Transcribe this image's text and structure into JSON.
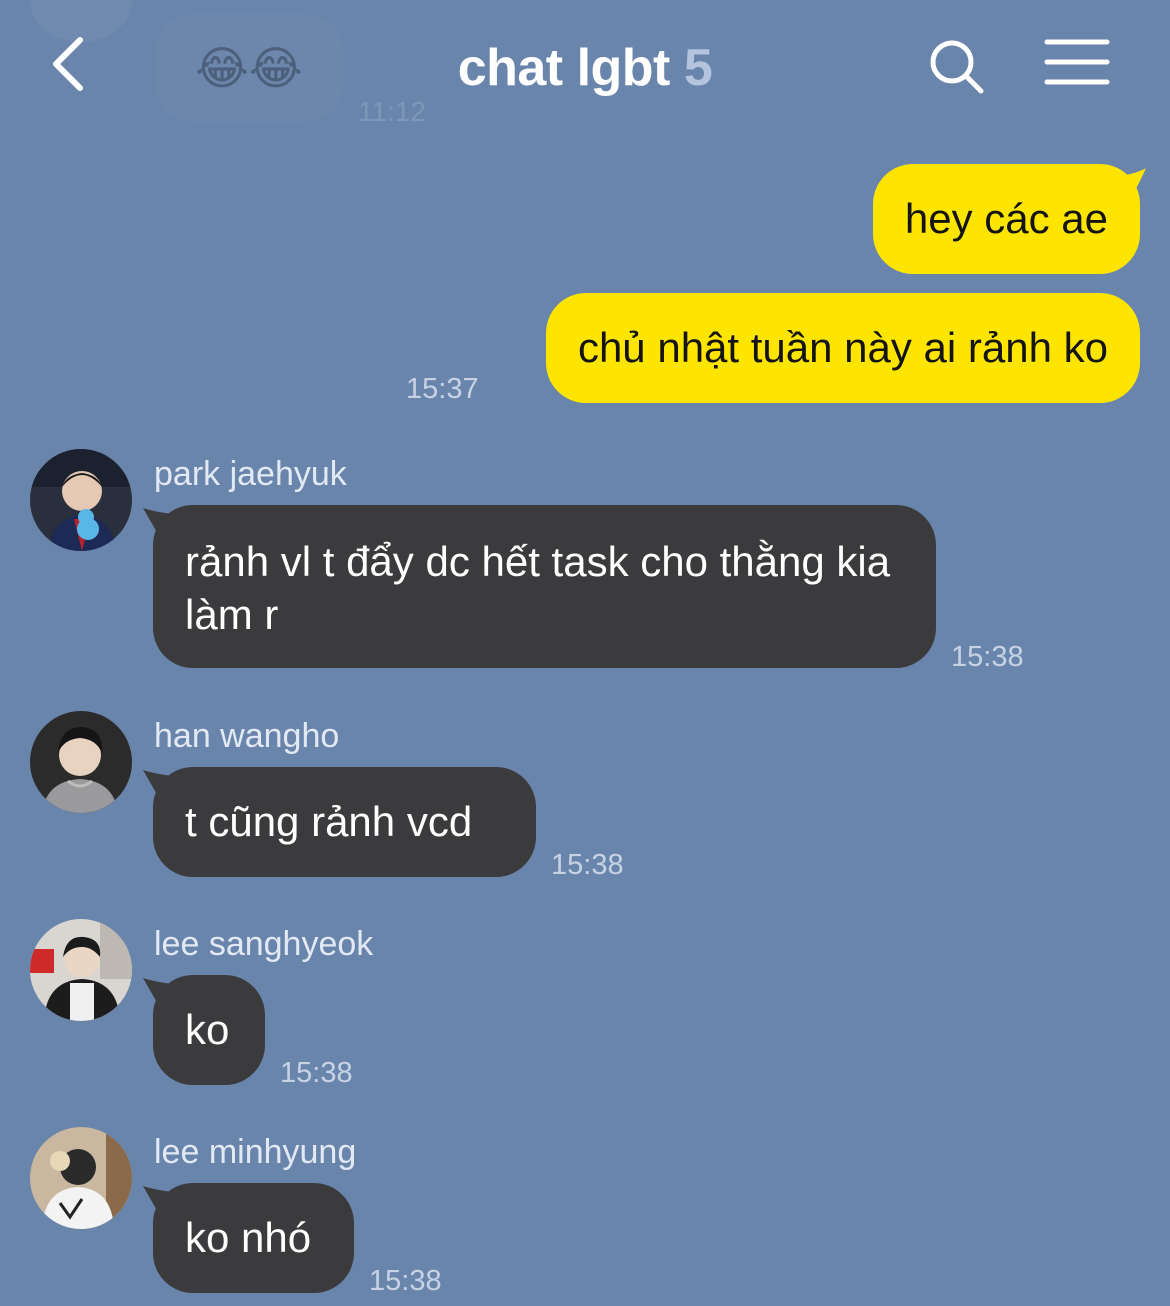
{
  "header": {
    "title": "chat lgbt",
    "member_count": "5"
  },
  "ghost_message": {
    "emoji": "😂😂",
    "time": "11:12"
  },
  "my_messages": [
    {
      "text": "hey các ae"
    },
    {
      "text": "chủ nhật tuần này ai rảnh ko"
    }
  ],
  "my_time": "15:37",
  "messages": [
    {
      "sender": "park jaehyuk",
      "text": "rảnh vl t đẩy dc hết task cho thằng kia làm r",
      "time": "15:38"
    },
    {
      "sender": "han wangho",
      "text": "t cũng rảnh vcd",
      "time": "15:38"
    },
    {
      "sender": "lee sanghyeok",
      "text": "ko",
      "time": "15:38"
    },
    {
      "sender": "lee minhyung",
      "text": "ko nhó",
      "time": "15:38"
    }
  ],
  "colors": {
    "background": "#6a85ac",
    "my_bubble": "#fee500",
    "other_bubble": "#3b3b3e",
    "time_text": "#c7d3e5",
    "title_count": "#b4c4de"
  },
  "icons": {
    "back": "chevron-left-icon",
    "search": "search-icon",
    "menu": "menu-icon"
  }
}
